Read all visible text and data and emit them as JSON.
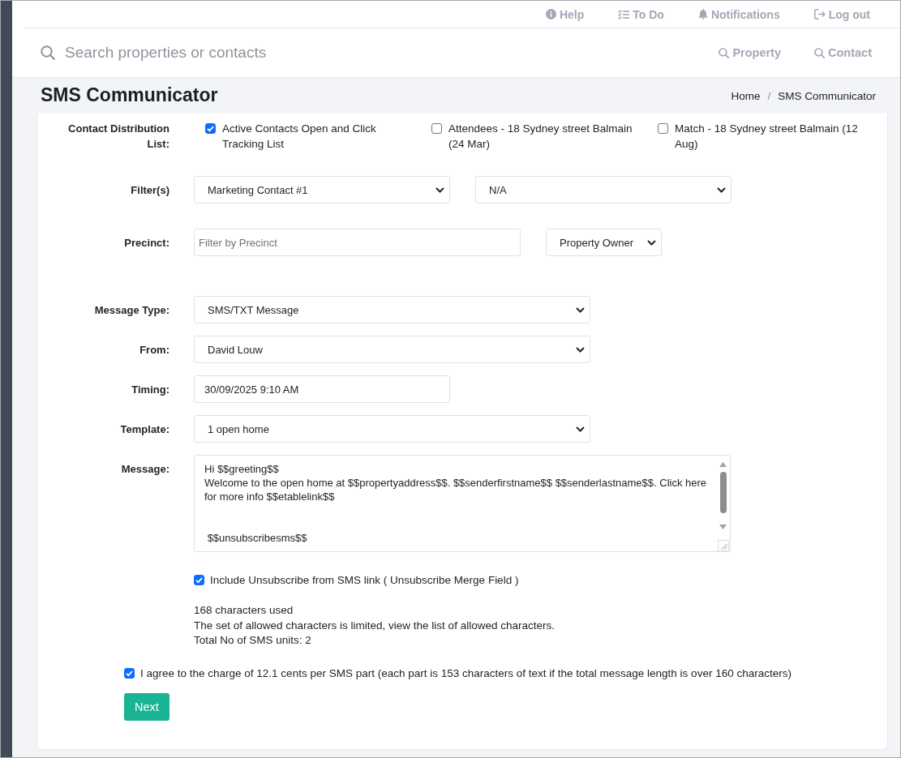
{
  "top_nav": [
    "Help",
    "To Do",
    "Notifications",
    "Log out"
  ],
  "search": {
    "placeholder": "Search properties or contacts",
    "scopes": [
      "Property",
      "Contact"
    ]
  },
  "page_header": {
    "title": "SMS Communicator",
    "breadcrumb": [
      "Home",
      "SMS Communicator"
    ],
    "separator": "/"
  },
  "form": {
    "distribution": {
      "label": "Contact Distribution List:",
      "options": [
        {
          "label": "Active Contacts Open and Click Tracking List",
          "checked": true
        },
        {
          "label": "Attendees - 18 Sydney street Balmain (24 Mar)",
          "checked": false
        },
        {
          "label": "Match - 18 Sydney street Balmain (12 Aug)",
          "checked": false
        }
      ]
    },
    "filters": {
      "label": "Filter(s)",
      "values": [
        "Marketing Contact #1",
        "N/A"
      ]
    },
    "precinct": {
      "label": "Precinct:",
      "placeholder": "Filter by Precinct",
      "type_value": "Property Owner"
    },
    "fields": [
      {
        "label": "Message Type:",
        "kind": "select",
        "value": "SMS/TXT Message"
      },
      {
        "label": "From:",
        "kind": "select",
        "value": "David Louw"
      },
      {
        "label": "Timing:",
        "kind": "input",
        "value": "30/09/2025 9:10 AM"
      },
      {
        "label": "Template:",
        "kind": "select",
        "value": "1 open home"
      }
    ],
    "message": {
      "label": "Message:",
      "value": "Hi $$greeting$$\nWelcome to the open home at $$propertyaddress$$. $$senderfirstname$$ $$senderlastname$$. Click here for more info $$etablelink$$\n\n\n $$unsubscribesms$$"
    },
    "unsubscribe": {
      "label": "Include Unsubscribe from SMS link ( Unsubscribe Merge Field )",
      "checked": true
    },
    "stats": [
      "168 characters used",
      "The set of allowed characters is limited, view the list of allowed characters.",
      "Total No of SMS units: 2"
    ],
    "agreement": {
      "label": "I agree to the charge of 12.1 cents per SMS part (each part is 153 characters of text if the total message length is over 160 characters)",
      "checked": true
    },
    "submit": "Next"
  }
}
